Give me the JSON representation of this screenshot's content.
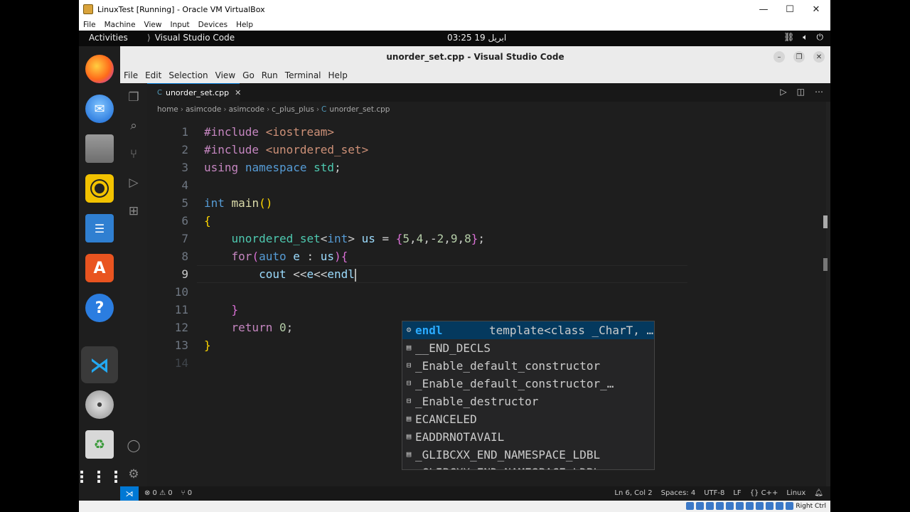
{
  "host": {
    "title": "LinuxTest [Running] - Oracle VM VirtualBox",
    "menu": [
      "File",
      "Machine",
      "View",
      "Input",
      "Devices",
      "Help"
    ],
    "host_key": "Right Ctrl"
  },
  "gnome": {
    "activities": "Activities",
    "app_name": "Visual Studio Code",
    "clock": "03:25 ابریل 19"
  },
  "dock": [
    "firefox-icon",
    "thunderbird-icon",
    "files-icon",
    "rhythmbox-icon",
    "writer-icon",
    "software-icon",
    "help-icon",
    "vscode-icon",
    "disc-icon",
    "trash-icon",
    "apps-grid-icon"
  ],
  "vscode": {
    "title": "unorder_set.cpp - Visual Studio Code",
    "menu": [
      "File",
      "Edit",
      "Selection",
      "View",
      "Go",
      "Run",
      "Terminal",
      "Help"
    ],
    "tab": {
      "icon": "C",
      "label": "unorder_set.cpp"
    },
    "breadcrumb": [
      "home",
      "asimcode",
      "asimcode",
      "c_plus_plus",
      "unorder_set.cpp"
    ],
    "line_numbers": [
      "1",
      "2",
      "3",
      "4",
      "5",
      "6",
      "7",
      "8",
      "9",
      "10",
      "11",
      "12",
      "13",
      "14"
    ],
    "current_line": 9,
    "suggest": [
      {
        "icon": "⚙",
        "label": "endl",
        "detail": "template<class _CharT, …"
      },
      {
        "icon": "▤",
        "label": "__END_DECLS",
        "detail": ""
      },
      {
        "icon": "⊟",
        "label": "_Enable_default_constructor",
        "detail": ""
      },
      {
        "icon": "⊟",
        "label": "_Enable_default_constructor_…",
        "detail": ""
      },
      {
        "icon": "⊟",
        "label": "_Enable_destructor",
        "detail": ""
      },
      {
        "icon": "▤",
        "label": "ECANCELED",
        "detail": ""
      },
      {
        "icon": "▤",
        "label": "EADDRNOTAVAIL",
        "detail": ""
      },
      {
        "icon": "▤",
        "label": "_GLIBCXX_END_NAMESPACE_LDBL",
        "detail": ""
      },
      {
        "icon": "▤",
        "label": "_GLIBCXX_END_NAMESPACE_LDBL",
        "detail": ""
      }
    ],
    "status": {
      "errors": "⊗ 0 ⚠ 0",
      "ports": "⑂ 0",
      "position": "Ln 6, Col 2",
      "spaces": "Spaces: 4",
      "encoding": "UTF-8",
      "eol": "LF",
      "language": "{} C++",
      "platform": "Linux"
    }
  }
}
